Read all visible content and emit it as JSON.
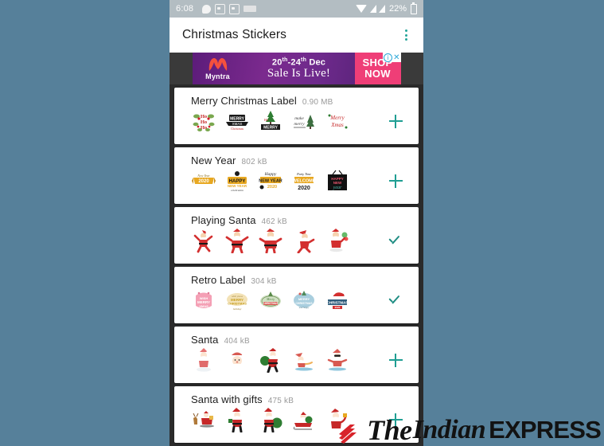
{
  "background_color": "#56809a",
  "statusbar": {
    "clock": "6:08",
    "battery_percent": "22%",
    "icons_left": [
      "chat-bubble-icon",
      "screenshot-icon",
      "screenshot-icon",
      "hindi-keyboard-icon"
    ],
    "icons_right": [
      "wifi-icon",
      "signal-icon",
      "signal-icon",
      "battery-icon"
    ]
  },
  "appbar": {
    "title": "Christmas Stickers",
    "overflow_menu": "overflow-menu-icon",
    "accent_color": "#26a69a"
  },
  "ad": {
    "brand": "Myntra",
    "line1_prefix": "20",
    "line1_sup1": "th",
    "line1_mid": "-24",
    "line1_sup2": "th",
    "line1_suffix": " Dec",
    "line2": "Sale Is Live!",
    "cta_line1": "SHOP",
    "cta_line2": "NOW",
    "badge_info": "i",
    "badge_close": "✕",
    "cta_color": "#ef3e77"
  },
  "packs": [
    {
      "name": "Merry Christmas Label",
      "size": "0.90 MB",
      "action": "add",
      "action_icon": "plus-icon",
      "stickers": [
        "ho-ho-ho-wreath",
        "merry-christmas-banner-black",
        "christmas-tree-label",
        "make-it-merry-tree",
        "merry-christmas-script"
      ]
    },
    {
      "name": "New Year",
      "size": "802 kB",
      "action": "add",
      "action_icon": "plus-icon",
      "stickers": [
        "new-year-2020-gold-ribbon",
        "happy-new-year-gold",
        "happy-new-year-2020-gold",
        "welcome-2020-gold",
        "happy-new-year-dark"
      ]
    },
    {
      "name": "Playing Santa",
      "size": "462 kB",
      "action": "added",
      "action_icon": "check-icon",
      "stickers": [
        "santa-dancing",
        "santa-jumping",
        "santa-cheering",
        "santa-running",
        "santa-with-balloons"
      ]
    },
    {
      "name": "Retro Label",
      "size": "304 kB",
      "action": "added",
      "action_icon": "check-icon",
      "stickers": [
        "pink-retro-badge",
        "cream-merry-christmas-badge",
        "green-merry-christmas-badge",
        "blue-merry-christmas-oval",
        "christmas-hat-badge"
      ]
    },
    {
      "name": "Santa",
      "size": "404 kB",
      "action": "add",
      "action_icon": "plus-icon",
      "stickers": [
        "santa-sitting",
        "santa-face",
        "santa-with-sack",
        "santa-sleeping",
        "santa-sunglasses"
      ]
    },
    {
      "name": "Santa with gifts",
      "size": "475 kB",
      "action": "add",
      "action_icon": "plus-icon",
      "stickers": [
        "santa-reindeer-sleigh",
        "santa-standing-gift",
        "santa-green-sack",
        "santa-sleigh-gifts",
        "santa-waving-gift"
      ]
    }
  ],
  "watermark": {
    "logo": "indian-express-logo",
    "the": "The",
    "indian": "Indian",
    "express": "EXPRESS",
    "logo_color": "#d8232a"
  }
}
